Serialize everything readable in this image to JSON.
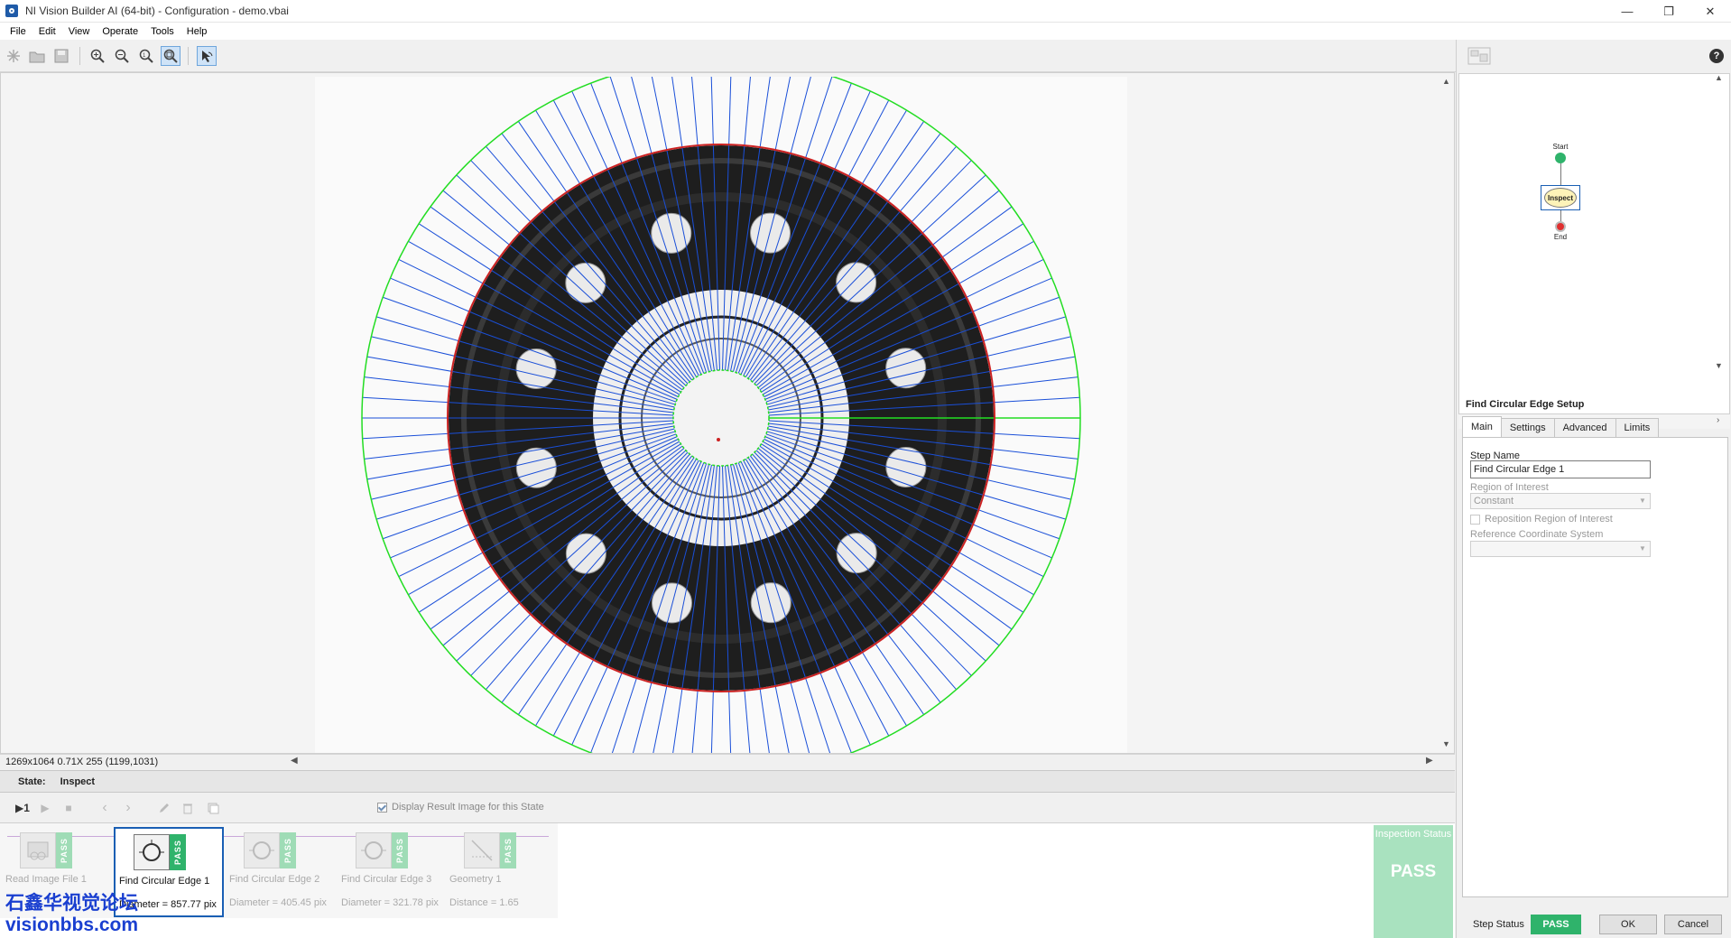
{
  "window": {
    "title": "NI Vision Builder AI (64-bit) - Configuration - demo.vbai",
    "minimize_glyph": "—",
    "maximize_glyph": "❐",
    "close_glyph": "✕"
  },
  "menu": [
    "File",
    "Edit",
    "View",
    "Operate",
    "Tools",
    "Help"
  ],
  "image_panel": {
    "info": "1269x1064 0.71X 255   (1199,1031)"
  },
  "state_bar": {
    "label": "State:",
    "value": "Inspect"
  },
  "step_toolbar": {
    "run_once_glyph": "▶1",
    "display_result_label": "Display Result Image for this State"
  },
  "steps": [
    {
      "name": "Read Image File 1",
      "result": "",
      "status": "PASS",
      "icon": "read-image-icon"
    },
    {
      "name": "Find Circular Edge 1",
      "result": "Diameter = 857.77 pix",
      "status": "PASS",
      "icon": "circular-edge-icon"
    },
    {
      "name": "Find Circular Edge 2",
      "result": "Diameter = 405.45 pix",
      "status": "PASS",
      "icon": "circular-edge-icon"
    },
    {
      "name": "Find Circular Edge 3",
      "result": "Diameter = 321.78 pix",
      "status": "PASS",
      "icon": "circular-edge-icon"
    },
    {
      "name": "Geometry 1",
      "result": "Distance = 1.65",
      "status": "PASS",
      "icon": "geometry-icon"
    }
  ],
  "inspection_status": {
    "label": "Inspection Status",
    "value": "PASS"
  },
  "watermark": {
    "line1": "石鑫华视觉论坛",
    "line2": "visionbbs.com"
  },
  "flow": {
    "start": "Start",
    "inspect": "Inspect",
    "end": "End"
  },
  "setup": {
    "title": "Find Circular Edge Setup",
    "tabs": [
      "Main",
      "Settings",
      "Advanced",
      "Limits"
    ],
    "step_name_label": "Step Name",
    "step_name_value": "Find Circular Edge 1",
    "roi_label": "Region of Interest",
    "roi_value": "Constant",
    "reposition_label": "Reposition Region of Interest",
    "ref_coord_label": "Reference Coordinate System",
    "ref_coord_value": ""
  },
  "footer": {
    "step_status_label": "Step Status",
    "step_status_value": "PASS",
    "ok_label": "OK",
    "cancel_label": "Cancel"
  },
  "colors": {
    "pass_green": "#2fb36b",
    "pass_green_light": "#a9e2bf",
    "roi_green": "#22dd22",
    "edge_red": "#cc2222",
    "search_line_blue": "#1a4fd8",
    "selection_blue": "#1a5fb4"
  }
}
